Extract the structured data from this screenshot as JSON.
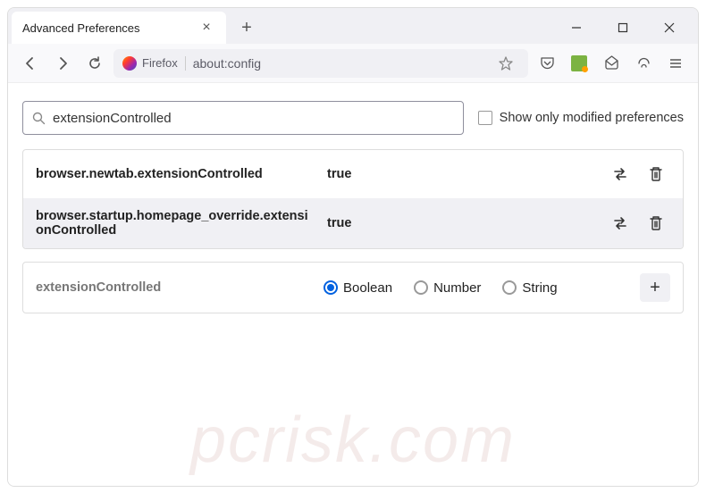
{
  "tab": {
    "title": "Advanced Preferences"
  },
  "urlbar": {
    "prefix": "Firefox",
    "url": "about:config"
  },
  "search": {
    "value": "extensionControlled",
    "checkbox_label": "Show only modified preferences"
  },
  "prefs": [
    {
      "name": "browser.newtab.extensionControlled",
      "value": "true"
    },
    {
      "name": "browser.startup.homepage_override.extensionControlled",
      "value": "true"
    }
  ],
  "new_pref": {
    "name": "extensionControlled",
    "types": [
      {
        "label": "Boolean",
        "checked": true
      },
      {
        "label": "Number",
        "checked": false
      },
      {
        "label": "String",
        "checked": false
      }
    ]
  },
  "watermark": "pcrisk.com"
}
